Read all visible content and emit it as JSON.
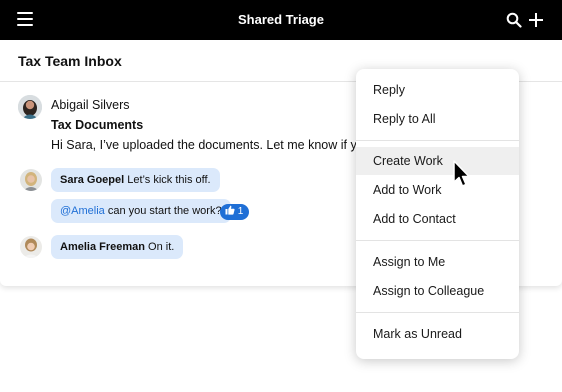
{
  "topbar": {
    "title": "Shared Triage",
    "menu_icon": "hamburger-icon",
    "search_icon": "search-icon",
    "add_icon": "plus-icon"
  },
  "inbox": {
    "name": "Tax Team Inbox"
  },
  "message": {
    "sender": "Abigail Silvers",
    "subject": "Tax Documents",
    "body": "Hi Sara, I’ve uploaded the documents. Let me know if you"
  },
  "comments": [
    {
      "author": "Sara Goepel",
      "text": " Let’s kick this off."
    },
    {
      "mention": "@Amelia",
      "text": " can you start the work?",
      "reaction_icon": "thumbs-up-icon",
      "reaction_count": "1"
    },
    {
      "author": "Amelia Freeman",
      "text": " On it."
    }
  ],
  "context_menu": {
    "items": [
      "Reply",
      "Reply to All",
      "Create Work",
      "Add to Work",
      "Add to Contact",
      "Assign to Me",
      "Assign to Colleague",
      "Mark as Unread"
    ],
    "highlighted": "Create Work"
  },
  "colors": {
    "topbar_bg": "#000000",
    "bubble_bg": "#dbe9fb",
    "accent": "#1f6fd6",
    "menu_hover": "#efefef"
  }
}
